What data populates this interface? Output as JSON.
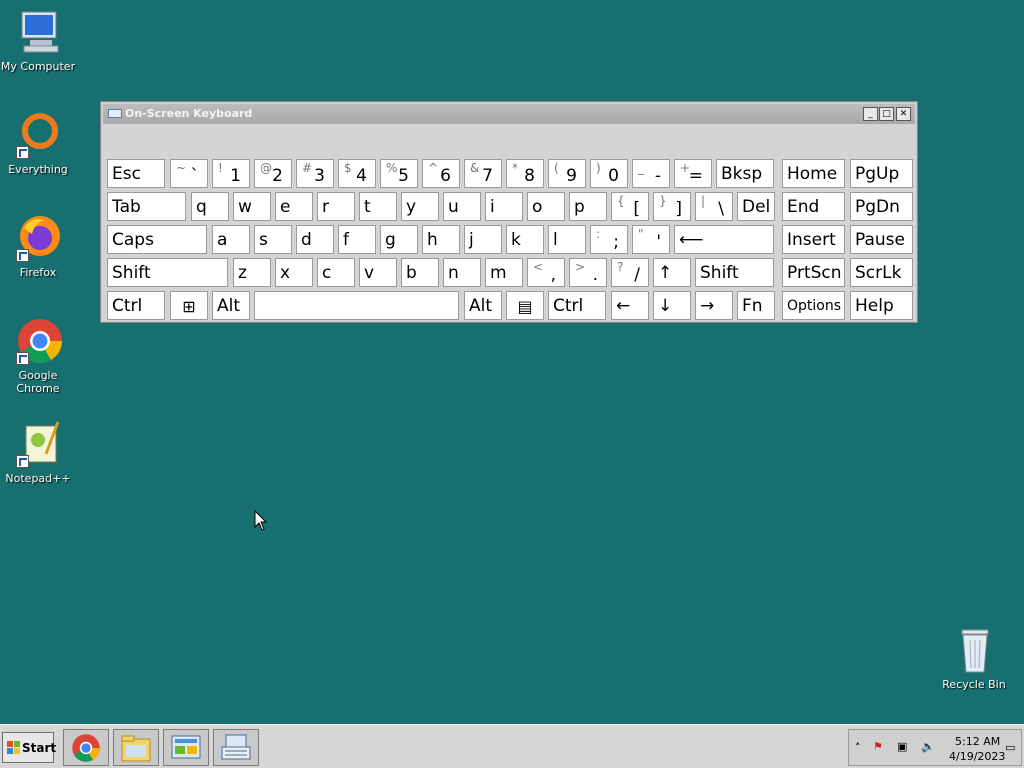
{
  "desktop": {
    "icons": [
      {
        "label": "My Computer"
      },
      {
        "label": "Everything"
      },
      {
        "label": "Firefox"
      },
      {
        "label": "Google Chrome"
      },
      {
        "label": "Notepad++"
      },
      {
        "label": "Recycle Bin"
      }
    ]
  },
  "osk": {
    "title": "On-Screen Keyboard",
    "rows": [
      [
        {
          "main": "Esc"
        },
        {
          "sub": "~",
          "main": "`"
        },
        {
          "sub": "!",
          "main": "1"
        },
        {
          "sub": "@",
          "main": "2"
        },
        {
          "sub": "#",
          "main": "3"
        },
        {
          "sub": "$",
          "main": "4"
        },
        {
          "sub": "%",
          "main": "5"
        },
        {
          "sub": "^",
          "main": "6"
        },
        {
          "sub": "&",
          "main": "7"
        },
        {
          "sub": "*",
          "main": "8"
        },
        {
          "sub": "(",
          "main": "9"
        },
        {
          "sub": ")",
          "main": "0"
        },
        {
          "sub": "_",
          "main": "-"
        },
        {
          "sub": "+",
          "main": "="
        },
        {
          "main": "Bksp"
        },
        {
          "main": "Home"
        },
        {
          "main": "PgUp"
        }
      ],
      [
        {
          "main": "Tab"
        },
        {
          "main": "q"
        },
        {
          "main": "w"
        },
        {
          "main": "e"
        },
        {
          "main": "r"
        },
        {
          "main": "t"
        },
        {
          "main": "y"
        },
        {
          "main": "u"
        },
        {
          "main": "i"
        },
        {
          "main": "o"
        },
        {
          "main": "p"
        },
        {
          "sub": "{",
          "main": "["
        },
        {
          "sub": "}",
          "main": "]"
        },
        {
          "sub": "|",
          "main": "\\"
        },
        {
          "main": "Del"
        },
        {
          "main": "End"
        },
        {
          "main": "PgDn"
        }
      ],
      [
        {
          "main": "Caps"
        },
        {
          "main": "a"
        },
        {
          "main": "s"
        },
        {
          "main": "d"
        },
        {
          "main": "f"
        },
        {
          "main": "g"
        },
        {
          "main": "h"
        },
        {
          "main": "j"
        },
        {
          "main": "k"
        },
        {
          "main": "l"
        },
        {
          "sub": ":",
          "main": ";"
        },
        {
          "sub": "\"",
          "main": "'"
        },
        {
          "main": "⟵"
        },
        {
          "main": "Insert"
        },
        {
          "main": "Pause"
        }
      ],
      [
        {
          "main": "Shift"
        },
        {
          "main": "z"
        },
        {
          "main": "x"
        },
        {
          "main": "c"
        },
        {
          "main": "v"
        },
        {
          "main": "b"
        },
        {
          "main": "n"
        },
        {
          "main": "m"
        },
        {
          "sub": "<",
          "main": ","
        },
        {
          "sub": ">",
          "main": "."
        },
        {
          "sub": "?",
          "main": "/"
        },
        {
          "main": "↑"
        },
        {
          "main": "Shift"
        },
        {
          "main": "PrtScn"
        },
        {
          "main": "ScrLk"
        }
      ],
      [
        {
          "main": "Ctrl"
        },
        {
          "icon": "windows-icon"
        },
        {
          "main": "Alt"
        },
        {
          "main": ""
        },
        {
          "main": "Alt"
        },
        {
          "icon": "menu-icon"
        },
        {
          "main": "Ctrl"
        },
        {
          "main": "←"
        },
        {
          "main": "↓"
        },
        {
          "main": "→"
        },
        {
          "main": "Fn"
        },
        {
          "main": "Options"
        },
        {
          "main": "Help"
        }
      ]
    ]
  },
  "taskbar": {
    "start_label": "Start",
    "apps": [
      "chrome-icon",
      "file-explorer-icon",
      "control-panel-icon",
      "on-screen-keyboard-icon"
    ],
    "clock_time": "5:12 AM",
    "clock_date": "4/19/2023"
  },
  "colors": {
    "desktop": "#17706f",
    "title_bar": "#a9a9a9"
  }
}
